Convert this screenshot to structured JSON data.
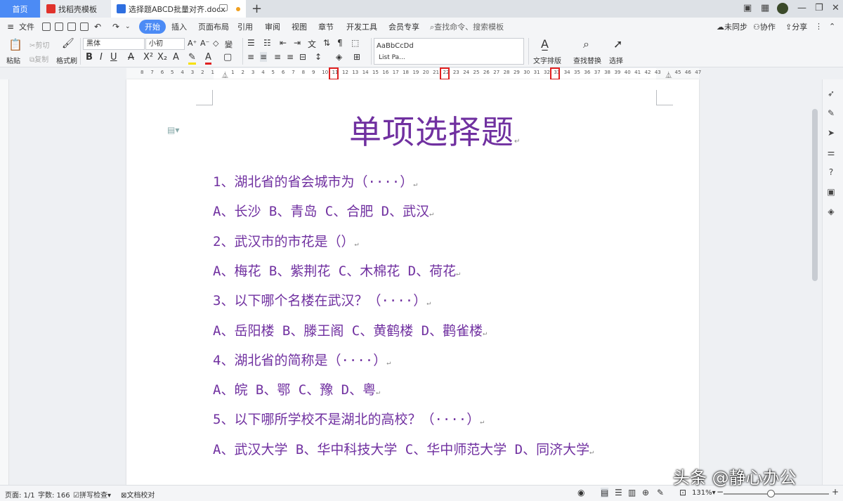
{
  "tabs": {
    "home": "首页",
    "template": "找稻壳模板",
    "document": "选择题ABCD批量对齐.docx"
  },
  "menu": {
    "file": "文件",
    "start": "开始",
    "insert": "插入",
    "layout": "页面布局",
    "reference": "引用",
    "review": "审阅",
    "view": "视图",
    "chapter": "章节",
    "developer": "开发工具",
    "member": "会员专享",
    "search_placeholder": "查找命令、搜索模板",
    "sync": "未同步",
    "collab": "协作",
    "share": "分享"
  },
  "ribbon": {
    "paste": "粘贴",
    "cut": "剪切",
    "copy": "复制",
    "format_painter": "格式刷",
    "font_name": "黑体",
    "font_size": "小初",
    "style_preview": "AaBbCcDd",
    "style_name": "List Pa...",
    "text_layout": "文字排版",
    "find_replace": "查找替换",
    "select": "选择"
  },
  "ruler": {
    "ticks": [
      "8",
      "7",
      "6",
      "5",
      "4",
      "3",
      "2",
      "1",
      "",
      "1",
      "2",
      "3",
      "4",
      "5",
      "6",
      "7",
      "8",
      "9",
      "10",
      "11",
      "12",
      "13",
      "14",
      "15",
      "16",
      "17",
      "18",
      "19",
      "20",
      "21",
      "22",
      "23",
      "24",
      "25",
      "26",
      "27",
      "28",
      "29",
      "30",
      "31",
      "32",
      "33",
      "34",
      "35",
      "36",
      "37",
      "38",
      "39",
      "40",
      "41",
      "42",
      "43",
      "",
      "45",
      "46",
      "47"
    ],
    "highlighted": [
      "11",
      "22",
      "33"
    ]
  },
  "document": {
    "title": "单项选择题",
    "lines": [
      "1、湖北省的省会城市为（····）",
      "A、长沙 B、青岛 C、合肥 D、武汉",
      "2、武汉市的市花是（）",
      "A、梅花 B、紫荆花 C、木棉花 D、荷花",
      "3、以下哪个名楼在武汉？（····）",
      "A、岳阳楼 B、滕王阁 C、黄鹤楼 D、鹳雀楼",
      "4、湖北省的简称是（····）",
      "A、皖 B、鄂 C、豫 D、粤",
      "5、以下哪所学校不是湖北的高校？（····）",
      "A、武汉大学 B、华中科技大学 C、华中师范大学 D、同济大学"
    ]
  },
  "status": {
    "page": "页面: 1/1",
    "words": "字数: 166",
    "spell": "拼写检查",
    "proof": "文档校对",
    "zoom": "131%"
  },
  "watermark": "头条 @静心办公",
  "colors": {
    "accent": "#4c8bf5",
    "doc_text": "#7030a0",
    "highlight_box": "#e02020"
  }
}
